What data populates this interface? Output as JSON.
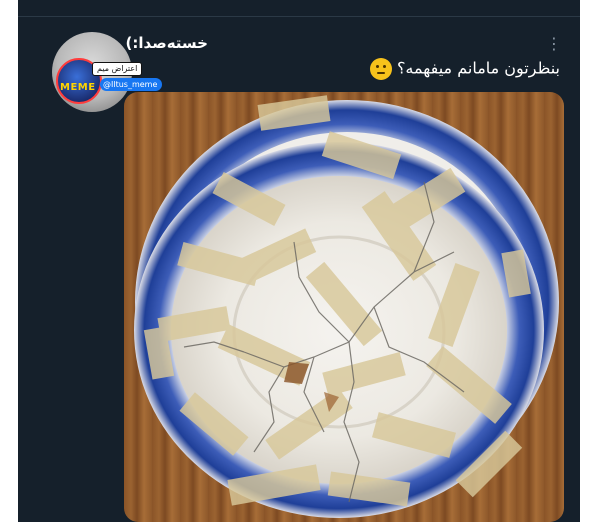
{
  "tweet": {
    "author_name": "خسته‌صدا:)",
    "text": "بنظرتون مامانم میفهمه؟",
    "emoji": "thinking-face-emoji",
    "more_icon": "more-vertical-icon",
    "image_alt": "taped broken plate"
  },
  "watermark": {
    "top_text": "اعتراض میم",
    "brand_text": "MEME",
    "bottom_text": "@Iltus_meme"
  },
  "colors": {
    "background": "#15202b",
    "text": "#ffffff",
    "muted": "#8b98a5",
    "plate_blue": "#1f3f98"
  }
}
